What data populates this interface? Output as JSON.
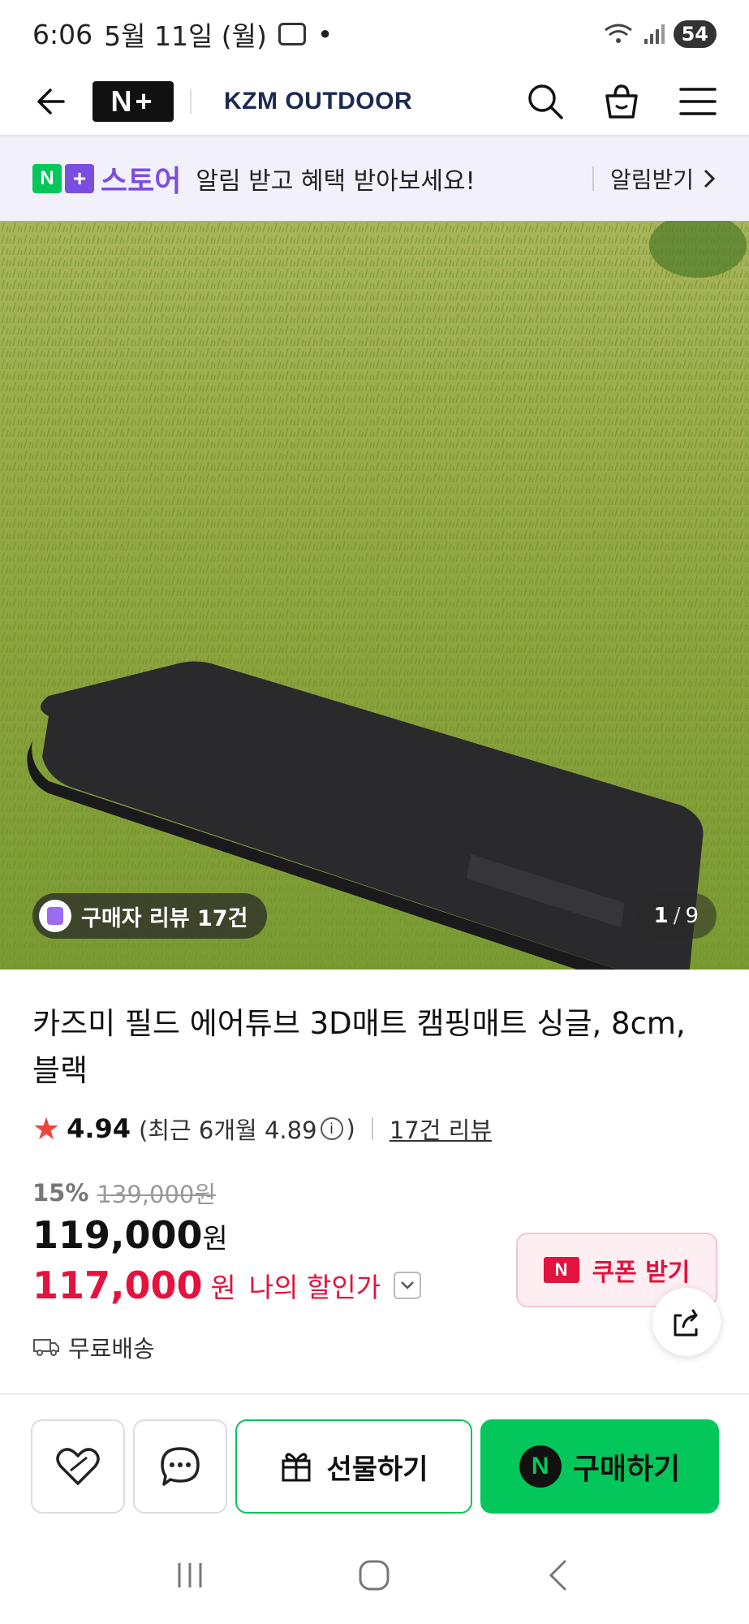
{
  "status": {
    "time": "6:06",
    "date": "5월 11일 (월)",
    "battery": "54"
  },
  "nav": {
    "badge": "N+",
    "brand": "KZM OUTDOOR",
    "icons": [
      "back-arrow-icon",
      "search-icon",
      "cart-icon",
      "menu-icon"
    ]
  },
  "promo": {
    "n": "N",
    "plus": "+",
    "store": "스토어",
    "message": "알림 받고 혜택 받아보세요!",
    "action": "알림받기"
  },
  "hero": {
    "review_chip": "구매자 리뷰 17건",
    "page_current": "1",
    "page_total": "9"
  },
  "product": {
    "title": "카즈미 필드 에어튜브 3D매트 캠핑매트 싱글, 8cm, 블랙",
    "rating": "4.94",
    "recent_open": "(최근 6개월 4.89",
    "recent_close": ")",
    "reviews_link": "17건 리뷰",
    "discount_pct": "15%",
    "original_price": "139,000원",
    "price": "119,000",
    "price_unit": "원",
    "my_price": "117,000",
    "my_price_unit": "원",
    "my_price_label": "나의 할인가",
    "coupon_label": "쿠폰 받기",
    "coupon_badge": "N",
    "delivery": "무료배송"
  },
  "actions": {
    "gift": "선물하기",
    "buy": "구매하기",
    "buy_badge": "N"
  },
  "colors": {
    "naver_green": "#03c75a",
    "accent_red": "#e3123e",
    "store_purple": "#7a4fe0"
  }
}
